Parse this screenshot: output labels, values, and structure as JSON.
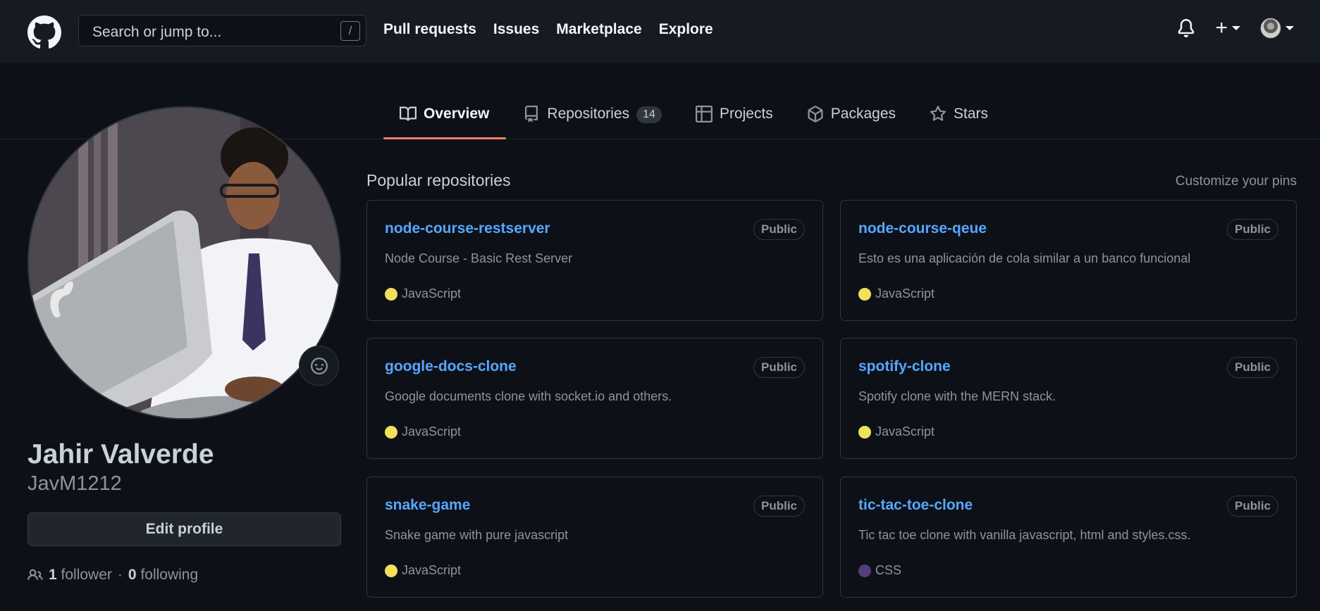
{
  "header": {
    "search_placeholder": "Search or jump to...",
    "search_shortcut": "/",
    "nav": [
      "Pull requests",
      "Issues",
      "Marketplace",
      "Explore"
    ]
  },
  "tabs": [
    {
      "label": "Overview",
      "icon": "book-icon",
      "active": true
    },
    {
      "label": "Repositories",
      "icon": "repo-icon",
      "count": "14"
    },
    {
      "label": "Projects",
      "icon": "table-icon"
    },
    {
      "label": "Packages",
      "icon": "package-icon"
    },
    {
      "label": "Stars",
      "icon": "star-icon"
    }
  ],
  "profile": {
    "name": "Jahir Valverde",
    "login": "JavM1212",
    "edit_label": "Edit profile",
    "followers_count": "1",
    "followers_label": "follower",
    "separator": "·",
    "following_count": "0",
    "following_label": "following"
  },
  "repos": {
    "title": "Popular repositories",
    "customize": "Customize your pins",
    "items": [
      {
        "name": "node-course-restserver",
        "badge": "Public",
        "desc": "Node Course - Basic Rest Server",
        "lang": "JavaScript",
        "color": "#f1e05a"
      },
      {
        "name": "node-course-qeue",
        "badge": "Public",
        "desc": "Esto es una aplicación de cola similar a un banco funcional",
        "lang": "JavaScript",
        "color": "#f1e05a"
      },
      {
        "name": "google-docs-clone",
        "badge": "Public",
        "desc": "Google documents clone with socket.io and others.",
        "lang": "JavaScript",
        "color": "#f1e05a"
      },
      {
        "name": "spotify-clone",
        "badge": "Public",
        "desc": "Spotify clone with the MERN stack.",
        "lang": "JavaScript",
        "color": "#f1e05a"
      },
      {
        "name": "snake-game",
        "badge": "Public",
        "desc": "Snake game with pure javascript",
        "lang": "JavaScript",
        "color": "#f1e05a"
      },
      {
        "name": "tic-tac-toe-clone",
        "badge": "Public",
        "desc": "Tic tac toe clone with vanilla javascript, html and styles.css.",
        "lang": "CSS",
        "color": "#563d7c"
      }
    ]
  },
  "colors": {
    "accent": "#58a6ff",
    "tab_underline": "#f78166",
    "background": "#0d1117",
    "header": "#161b22"
  }
}
